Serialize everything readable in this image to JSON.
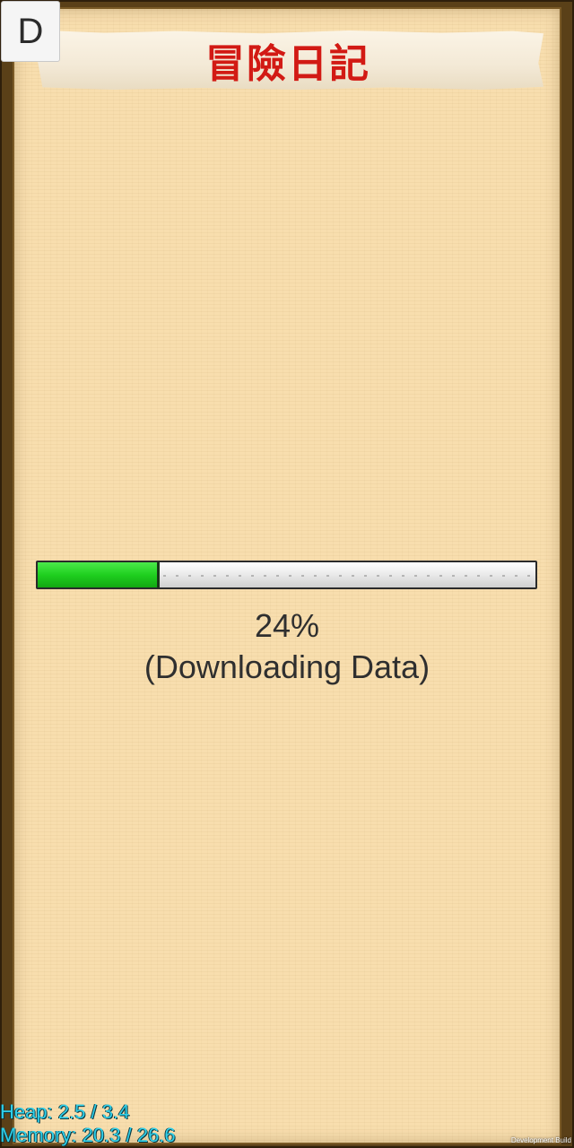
{
  "dev_button": {
    "label": "D"
  },
  "title": "冒險日記",
  "loader": {
    "progress": 0.24,
    "percent_text": "24%",
    "status_text": "(Downloading Data)",
    "fill_color": "#22cc22",
    "track_color": "#e8e8e8"
  },
  "debug": {
    "heap": "Heap: 2.5 / 3.4",
    "memory": "Memory: 20.3 / 26.6",
    "build": "Development Build",
    "text_color": "#2fd0ea"
  },
  "colors": {
    "paper": "#f8deae",
    "frame": "#5a4018",
    "title_red": "#d21a14"
  }
}
